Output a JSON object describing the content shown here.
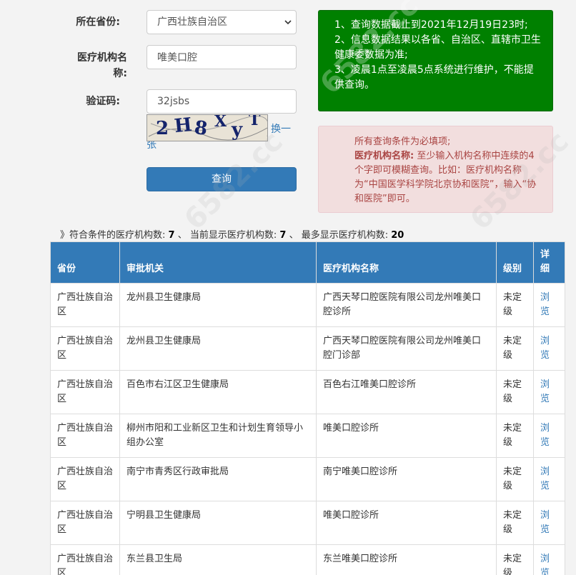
{
  "form": {
    "province_label": "所在省份:",
    "province_value": "广西壮族自治区",
    "org_label": "医疗机构名称:",
    "org_value": "唯美口腔",
    "code_label": "验证码:",
    "code_value": "32jsbs",
    "captcha_chars": [
      "2",
      "H",
      "8",
      "X",
      "y",
      "T"
    ],
    "refresh_label": "换一张",
    "query_label": "查询"
  },
  "notice_green": {
    "lines": [
      "1、查询数据截止到2021年12月19日23时;",
      "2、信息数据结果以各省、自治区、直辖市卫生健康委数据为准;",
      "3、凌晨1点至凌晨5点系统进行维护，不能提供查询。"
    ]
  },
  "notice_red": {
    "line1": "所有查询条件为必填项;",
    "bold_label": "医疗机构名称:",
    "line2": "至少输入机构名称中连续的4个字即可模糊查询。比如：医疗机构名称为“中国医学科学院北京协和医院”，输入“协和医院”即可。"
  },
  "summary": {
    "prefix": "》符合条件的医疗机构数:",
    "match_count": "7",
    "sep1": "、 当前显示医疗机构数:",
    "shown_count": "7",
    "sep2": "、 最多显示医疗机构数:",
    "max_count": "20"
  },
  "table": {
    "headers": [
      "省份",
      "审批机关",
      "医疗机构名称",
      "级别",
      "详细"
    ],
    "rows": [
      [
        "广西壮族自治区",
        "龙州县卫生健康局",
        "广西天琴口腔医院有限公司龙州唯美口腔诊所",
        "未定级",
        "浏览"
      ],
      [
        "广西壮族自治区",
        "龙州县卫生健康局",
        "广西天琴口腔医院有限公司龙州唯美口腔门诊部",
        "未定级",
        "浏览"
      ],
      [
        "广西壮族自治区",
        "百色市右江区卫生健康局",
        "百色右江唯美口腔诊所",
        "未定级",
        "浏览"
      ],
      [
        "广西壮族自治区",
        "柳州市阳和工业新区卫生和计划生育领导小组办公室",
        "唯美口腔诊所",
        "未定级",
        "浏览"
      ],
      [
        "广西壮族自治区",
        "南宁市青秀区行政审批局",
        "南宁唯美口腔诊所",
        "未定级",
        "浏览"
      ],
      [
        "广西壮族自治区",
        "宁明县卫生健康局",
        "唯美口腔诊所",
        "未定级",
        "浏览"
      ],
      [
        "广西壮族自治区",
        "东兰县卫生局",
        "东兰唯美口腔诊所",
        "未定级",
        "浏览"
      ]
    ]
  },
  "watermark": "6582.cc",
  "colors": {
    "primary": "#337ab7",
    "success_bg": "#008000",
    "danger_bg": "#f2dede",
    "danger_text": "#a94442"
  }
}
